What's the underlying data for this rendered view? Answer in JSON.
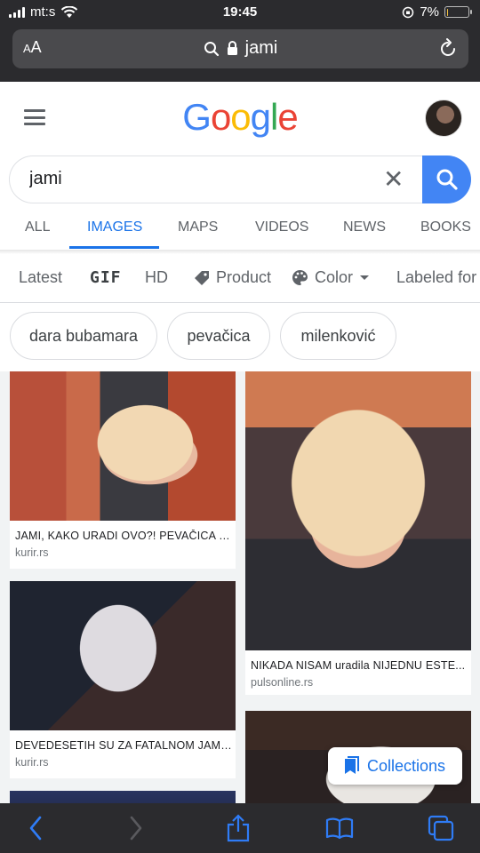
{
  "status_bar": {
    "carrier": "mt:s",
    "time": "19:45",
    "battery_pct": "7%",
    "battery_level": 0.07
  },
  "safari": {
    "aa_small": "A",
    "aa_large": "A",
    "url": "jami"
  },
  "google": {
    "logo_letters": [
      "G",
      "o",
      "o",
      "g",
      "l",
      "e"
    ],
    "logo_colors": [
      "#4285f4",
      "#ea4335",
      "#fbbc05",
      "#4285f4",
      "#34a853",
      "#ea4335"
    ],
    "search_value": "jami",
    "clear_symbol": "✕",
    "tabs": [
      "ALL",
      "IMAGES",
      "MAPS",
      "VIDEOS",
      "NEWS",
      "BOOKS"
    ],
    "active_tab": "IMAGES",
    "filters": [
      "Latest",
      "GIF",
      "HD",
      "Product",
      "Color",
      "Labeled for"
    ],
    "chips": [
      "dara bubamara",
      "pevačica",
      "milenković"
    ]
  },
  "results": [
    {
      "caption": "JAMI, KAKO URADI OVO?! PEVAČICA U...",
      "source": "kurir.rs"
    },
    {
      "caption": "NIKADA NISAM uradila NIJEDNU ESTE...",
      "source": "pulsonline.rs"
    },
    {
      "caption": "DEVEDESETIH SU ZA FATALNOM JAMI...",
      "source": "kurir.rs"
    }
  ],
  "collections_label": "Collections",
  "colors": {
    "accent": "#1a73e8",
    "search_button": "#4285f4",
    "chrome_dark": "#2b2b2e",
    "battery_low": "#f5c242"
  }
}
